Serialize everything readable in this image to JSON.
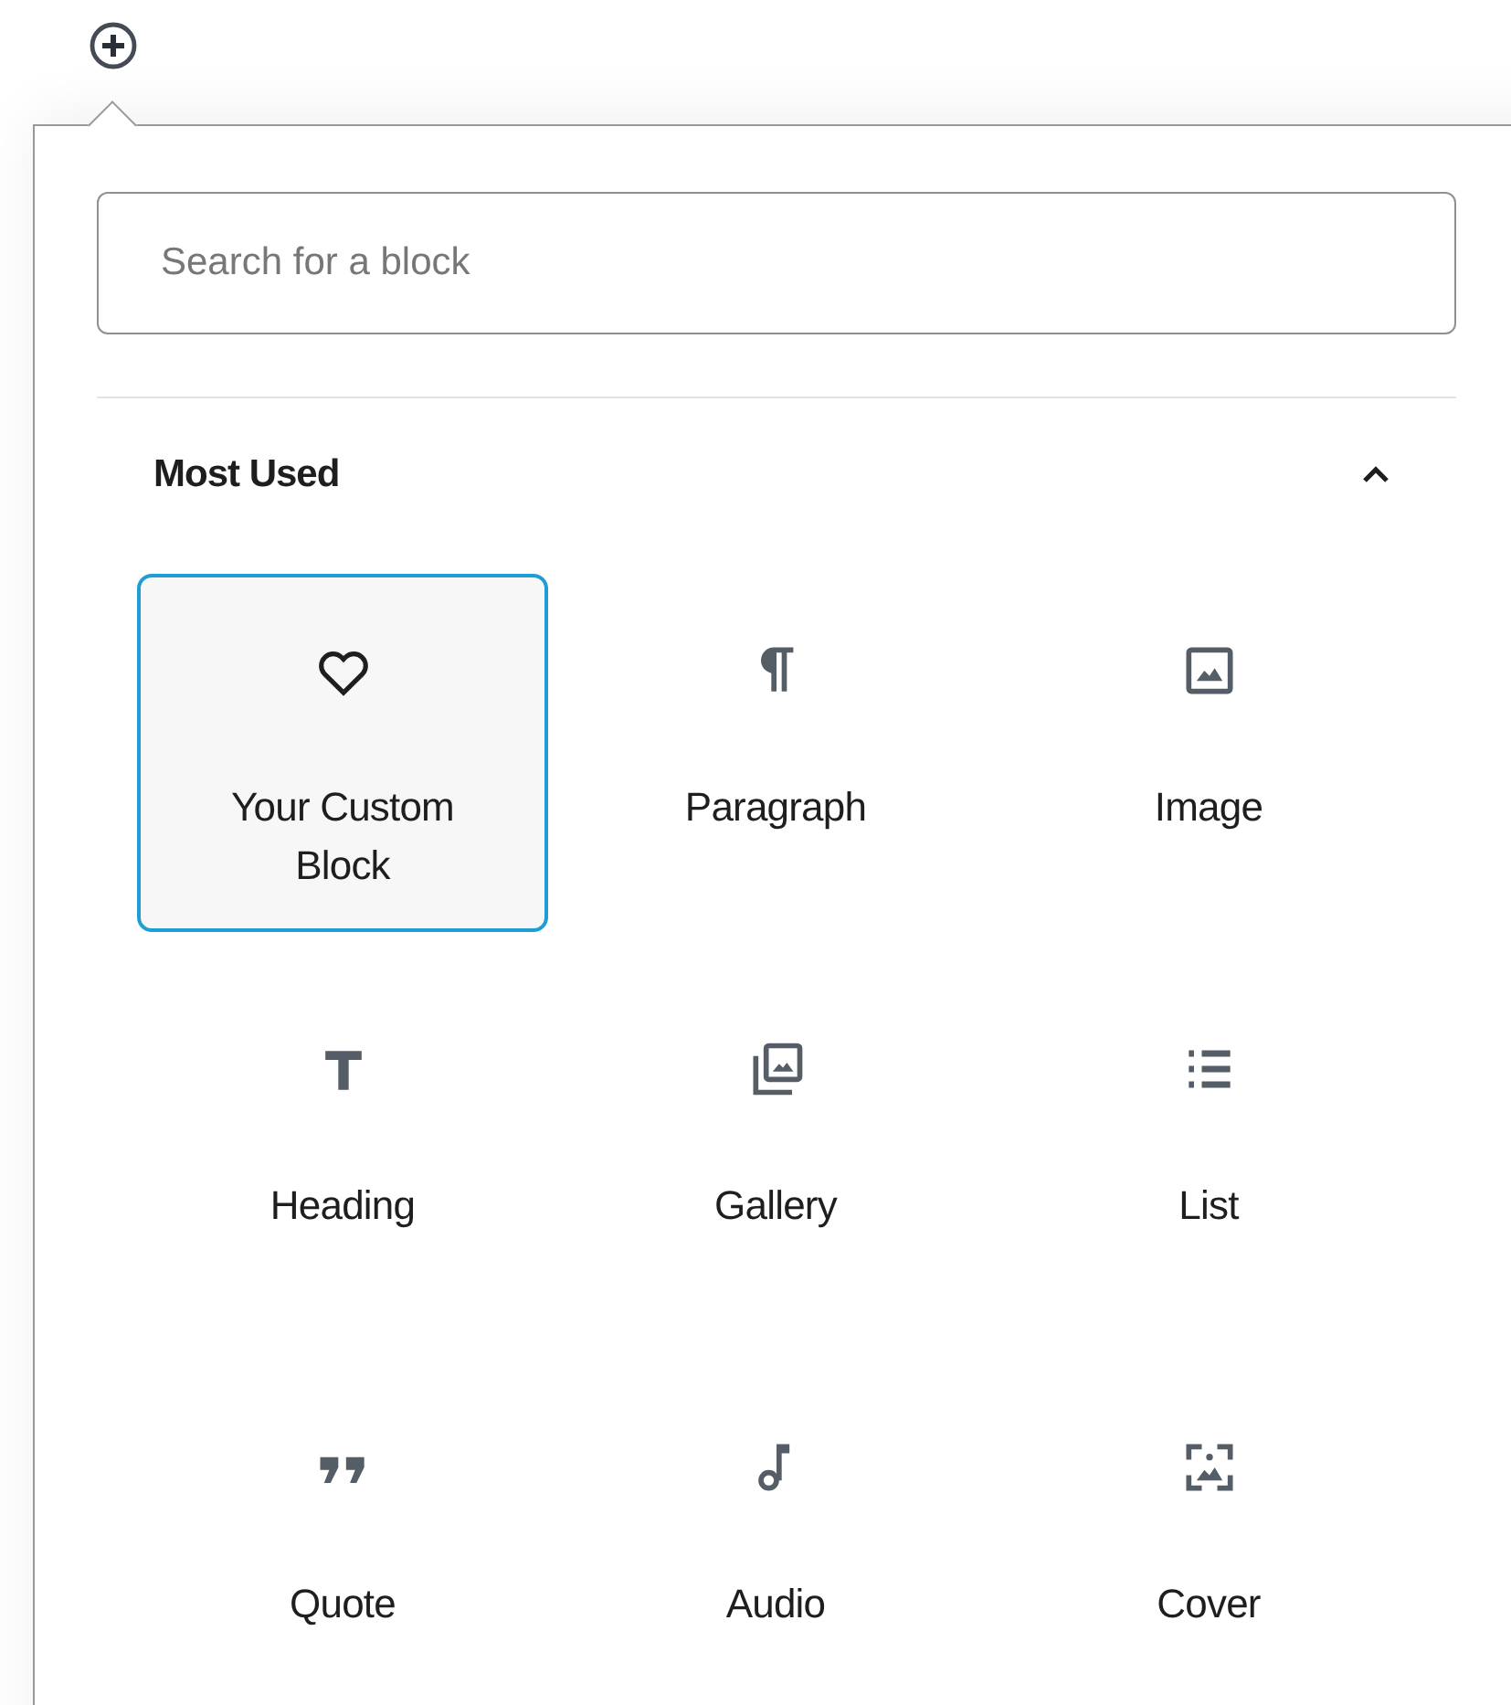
{
  "search": {
    "placeholder": "Search for a block"
  },
  "panel": {
    "title": "Most Used",
    "expanded": true
  },
  "blocks": [
    {
      "label": "Your Custom Block",
      "kind": "heart",
      "selected": true
    },
    {
      "label": "Paragraph",
      "kind": "pilcrow",
      "selected": false
    },
    {
      "label": "Image",
      "kind": "image",
      "selected": false
    },
    {
      "label": "Heading",
      "kind": "heading",
      "selected": false
    },
    {
      "label": "Gallery",
      "kind": "gallery",
      "selected": false
    },
    {
      "label": "List",
      "kind": "list",
      "selected": false
    },
    {
      "label": "Quote",
      "kind": "quote",
      "selected": false
    },
    {
      "label": "Audio",
      "kind": "audio",
      "selected": false
    },
    {
      "label": "Cover",
      "kind": "cover",
      "selected": false
    }
  ]
}
